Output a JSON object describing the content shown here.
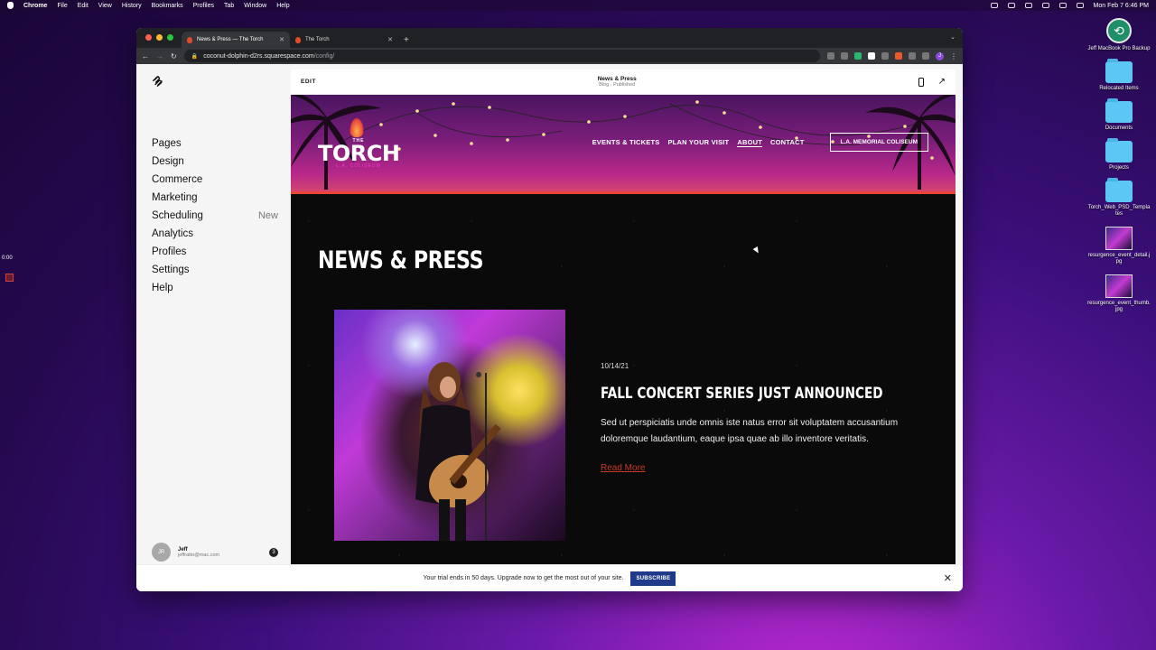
{
  "menubar": {
    "app": "Chrome",
    "items": [
      "File",
      "Edit",
      "View",
      "History",
      "Bookmarks",
      "Profiles",
      "Tab",
      "Window",
      "Help"
    ],
    "clock": "Mon Feb 7  6:46 PM"
  },
  "desktop": {
    "items": [
      {
        "label": "Jeff MacBook Pro Backup",
        "kind": "timemachine"
      },
      {
        "label": "Relocated Items",
        "kind": "folder"
      },
      {
        "label": "Documents",
        "kind": "folder"
      },
      {
        "label": "Projects",
        "kind": "folder"
      },
      {
        "label": "Torch_Web_PSD_Templates",
        "kind": "folder"
      },
      {
        "label": "resurgence_event_detail.jpg",
        "kind": "image"
      },
      {
        "label": "resurgence_event_thumb.jpg",
        "kind": "image"
      }
    ]
  },
  "recorder": {
    "time": "0:00"
  },
  "browser": {
    "tabs": [
      {
        "label": "News & Press — The Torch",
        "active": true
      },
      {
        "label": "The Torch",
        "active": false
      }
    ],
    "url": {
      "host": "coconut-dolphin-d2rs.squarespace.com",
      "path": "/config/"
    }
  },
  "sidebar": {
    "nav": [
      {
        "label": "Pages",
        "badge": ""
      },
      {
        "label": "Design",
        "badge": ""
      },
      {
        "label": "Commerce",
        "badge": ""
      },
      {
        "label": "Marketing",
        "badge": ""
      },
      {
        "label": "Scheduling",
        "badge": "New"
      },
      {
        "label": "Analytics",
        "badge": ""
      },
      {
        "label": "Profiles",
        "badge": ""
      },
      {
        "label": "Settings",
        "badge": ""
      },
      {
        "label": "Help",
        "badge": ""
      }
    ],
    "user": {
      "initials": "JR",
      "name": "Jeff",
      "email": "jeffratto@mac.com",
      "notifications": "3"
    }
  },
  "editor": {
    "edit_label": "EDIT",
    "page_title": "News & Press",
    "page_status": "Blog · Published"
  },
  "site": {
    "logo": {
      "the": "THE",
      "name": "TORCH",
      "sub": "L.A. COLISEUM"
    },
    "nav": [
      "EVENTS & TICKETS",
      "PLAN YOUR VISIT",
      "ABOUT",
      "CONTACT"
    ],
    "nav_active": "ABOUT",
    "cta": "L.A. MEMORIAL COLISEUM",
    "heading": "NEWS & PRESS",
    "post": {
      "date": "10/14/21",
      "title": "FALL CONCERT SERIES JUST ANNOUNCED",
      "excerpt": "Sed ut perspiciatis unde omnis iste natus error sit voluptatem accusantium doloremque laudantium, eaque ipsa quae ab illo inventore veritatis.",
      "read_more": "Read More"
    }
  },
  "trial": {
    "message": "Your trial ends in 50 days. Upgrade now to get the most out of your site.",
    "button": "SUBSCRIBE"
  },
  "colors": {
    "accent": "#1f3a8a",
    "read_more": "#c43a2a",
    "header_glow": "#b8288a"
  }
}
